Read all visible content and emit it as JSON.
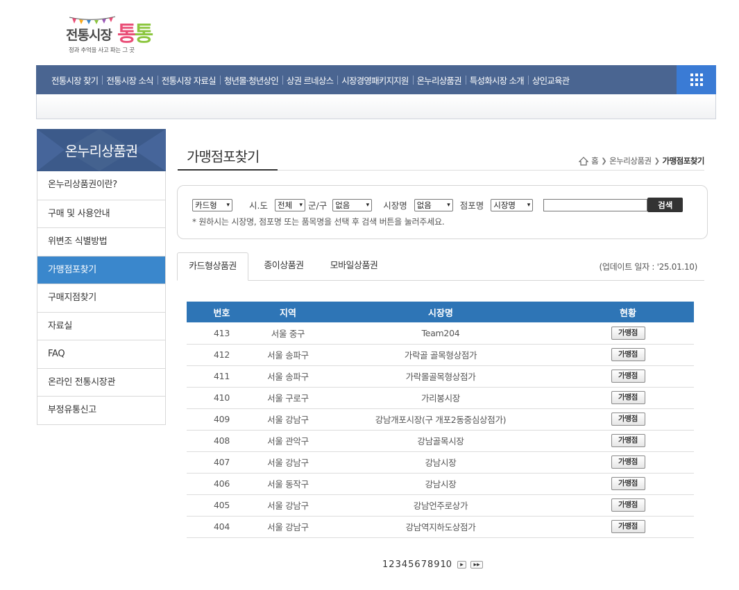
{
  "logo": {
    "main": "전통시장",
    "tong1": "통",
    "tong2": "통",
    "slogan": "정과 추억을 사고 파는 그 곳"
  },
  "gnb": {
    "items": [
      {
        "label": "전통시장 찾기"
      },
      {
        "label": "전통시장 소식"
      },
      {
        "label": "전통시장 자료실"
      },
      {
        "label": "청년몰·청년상인"
      },
      {
        "label": "상권 르네상스"
      },
      {
        "label": "시장경영패키지지원"
      },
      {
        "label": "온누리상품권"
      },
      {
        "label": "특성화시장 소개"
      },
      {
        "label": "상인교육관"
      }
    ],
    "allmenu_icon": "grid-menu-icon"
  },
  "lnb": {
    "title": "온누리상품권",
    "items": [
      {
        "label": "온누리상품권이란?"
      },
      {
        "label": "구매 및 사용안내"
      },
      {
        "label": "위변조 식별방법"
      },
      {
        "label": "가맹점포찾기"
      },
      {
        "label": "구매지점찾기"
      },
      {
        "label": "자료실"
      },
      {
        "label": "FAQ"
      },
      {
        "label": "온라인 전통시장관"
      },
      {
        "label": "부정유통신고"
      }
    ],
    "active_index": 3
  },
  "page": {
    "title": "가맹점포찾기",
    "breadcrumb": {
      "home": "홈",
      "level1": "온누리상품권",
      "current": "가맹점포찾기"
    }
  },
  "search": {
    "type_value": "카드형",
    "sido_label": "시.도",
    "sido_value": "전체",
    "gungu_label": "군/구",
    "gungu_value": "없음",
    "market_label": "시장명",
    "market_value": "없음",
    "store_label": "점포명",
    "store_value": "시장명",
    "button": "검색",
    "note": "* 원하시는 시장명, 점포명 또는 품목명을 선택 후 검색 버튼을 눌러주세요."
  },
  "tabs": [
    {
      "label": "카드형상품권"
    },
    {
      "label": "종이상품권"
    },
    {
      "label": "모바일상품권"
    }
  ],
  "update_text": "(업데이트 일자 : '25.01.10)",
  "table": {
    "headers": {
      "no": "번호",
      "region": "지역",
      "market": "시장명",
      "status": "현황"
    },
    "button_label": "가맹점",
    "rows": [
      {
        "no": "413",
        "region": "서울 중구",
        "market": "Team204"
      },
      {
        "no": "412",
        "region": "서울 송파구",
        "market": "가락골 골목형상점가"
      },
      {
        "no": "411",
        "region": "서울 송파구",
        "market": "가락몰골목형상점가"
      },
      {
        "no": "410",
        "region": "서울 구로구",
        "market": "가리봉시장"
      },
      {
        "no": "409",
        "region": "서울 강남구",
        "market": "강남개포시장(구 개포2동중심상점가)"
      },
      {
        "no": "408",
        "region": "서울 관악구",
        "market": "강남골목시장"
      },
      {
        "no": "407",
        "region": "서울 강남구",
        "market": "강남시장"
      },
      {
        "no": "406",
        "region": "서울 동작구",
        "market": "강남시장"
      },
      {
        "no": "405",
        "region": "서울 강남구",
        "market": "강남언주로상가"
      },
      {
        "no": "404",
        "region": "서울 강남구",
        "market": "강남역지하도상점가"
      }
    ]
  },
  "paging": {
    "pages": [
      "1",
      "2",
      "3",
      "4",
      "5",
      "6",
      "7",
      "8",
      "9",
      "10"
    ],
    "next": "▶",
    "last": "▶▶"
  }
}
